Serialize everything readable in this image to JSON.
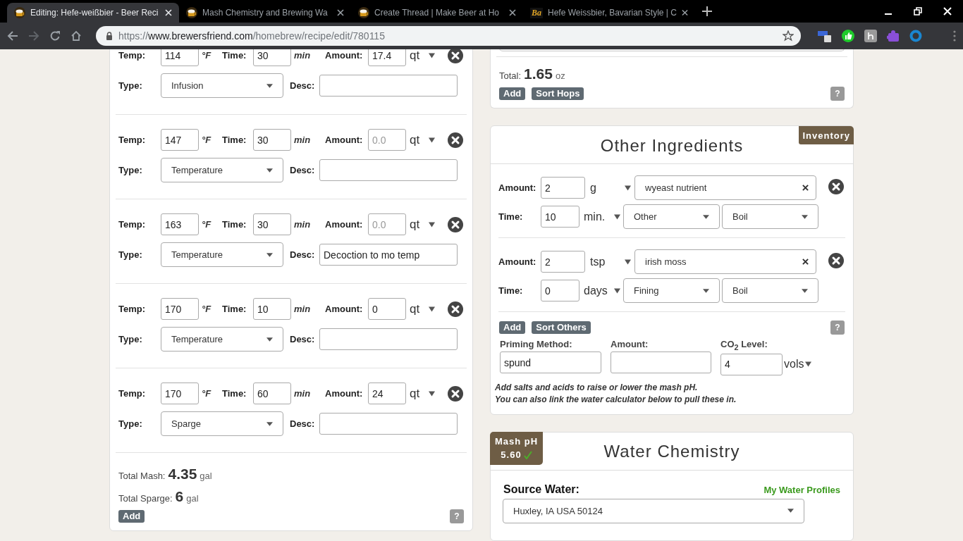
{
  "browser": {
    "tabs": [
      {
        "title": "Editing: Hefe-weißbier - Beer Reci",
        "kind": "mug",
        "selected": true
      },
      {
        "title": "Mash Chemistry and Brewing Wa",
        "kind": "mug",
        "selected": false
      },
      {
        "title": "Create Thread | Make Beer at Ho",
        "kind": "mug",
        "selected": false
      },
      {
        "title": "Hefe Weissbier, Bavarian Style | C",
        "kind": "letters",
        "icon_text": "Ba",
        "selected": false
      }
    ],
    "url": {
      "scheme": "https://",
      "host": "www.brewersfriend.com",
      "path": "/homebrew/recipe/edit/780115"
    }
  },
  "mash": {
    "steps": [
      {
        "temp": {
          "label": "Temp:",
          "value": "114",
          "unit": "°F"
        },
        "time": {
          "label": "Time:",
          "value": "30",
          "unit": "min"
        },
        "amount": {
          "label": "Amount:",
          "value": "17.4",
          "unit": "qt"
        },
        "type": {
          "label": "Type:",
          "value": "Infusion"
        },
        "desc": {
          "label": "Desc:"
        }
      },
      {
        "temp": {
          "label": "Temp:",
          "value": "147",
          "unit": "°F"
        },
        "time": {
          "label": "Time:",
          "value": "30",
          "unit": "min"
        },
        "amount": {
          "label": "Amount:",
          "placeholder": "0.0",
          "unit": "qt"
        },
        "type": {
          "label": "Type:",
          "value": "Temperature"
        },
        "desc": {
          "label": "Desc:"
        }
      },
      {
        "temp": {
          "label": "Temp:",
          "value": "163",
          "unit": "°F"
        },
        "time": {
          "label": "Time:",
          "value": "30",
          "unit": "min"
        },
        "amount": {
          "label": "Amount:",
          "placeholder": "0.0",
          "unit": "qt"
        },
        "type": {
          "label": "Type:",
          "value": "Temperature"
        },
        "desc": {
          "label": "Desc:",
          "value": "Decoction to mo temp"
        }
      },
      {
        "temp": {
          "label": "Temp:",
          "value": "170",
          "unit": "°F"
        },
        "time": {
          "label": "Time:",
          "value": "10",
          "unit": "min"
        },
        "amount": {
          "label": "Amount:",
          "value": "0",
          "unit": "qt"
        },
        "type": {
          "label": "Type:",
          "value": "Temperature"
        },
        "desc": {
          "label": "Desc:"
        }
      },
      {
        "temp": {
          "label": "Temp:",
          "value": "170",
          "unit": "°F"
        },
        "time": {
          "label": "Time:",
          "value": "60",
          "unit": "min"
        },
        "amount": {
          "label": "Amount:",
          "value": "24",
          "unit": "qt"
        },
        "type": {
          "label": "Type:",
          "value": "Sparge"
        },
        "desc": {
          "label": "Desc:"
        }
      }
    ],
    "total_mash": {
      "label": "Total Mash:",
      "value": "4.35",
      "unit": "gal"
    },
    "total_sparge": {
      "label": "Total Sparge:",
      "value": "6",
      "unit": "gal"
    },
    "buttons": [
      "Add"
    ],
    "help": "?"
  },
  "hops": {
    "total": {
      "label": "Total:",
      "value": "1.65",
      "unit": "oz"
    },
    "buttons": [
      "Add",
      "Sort Hops"
    ],
    "help": "?"
  },
  "other_ingredients": {
    "title": "Other Ingredients",
    "inventory_tab": "Inventory",
    "items": [
      {
        "amount_label": "Amount:",
        "amount": "2",
        "unit": "g",
        "name": "wyeast nutrient",
        "time_label": "Time:",
        "time": "10",
        "time_unit": "min.",
        "use": "Other",
        "stage": "Boil"
      },
      {
        "amount_label": "Amount:",
        "amount": "2",
        "unit": "tsp",
        "name": "irish moss",
        "time_label": "Time:",
        "time": "0",
        "time_unit": "days",
        "use": "Fining",
        "stage": "Boil"
      }
    ],
    "buttons": [
      "Add",
      "Sort Others"
    ],
    "help": "?",
    "priming": {
      "method_label": "Priming Method:",
      "method": "spund",
      "amount_label": "Amount:",
      "co2_label": "CO$_{2}$ Level:",
      "co2": "4",
      "co2_unit": "vols"
    },
    "notes": [
      "Add salts and acids to raise or lower the mash pH.",
      "You can also link the water calculator below to pull these in."
    ]
  },
  "water_chemistry": {
    "badge": {
      "label": "Mash pH",
      "value": "5.60",
      "ok": true
    },
    "title": "Water Chemistry",
    "source_label": "Source Water:",
    "profiles_link": "My Water Profiles",
    "source": "Huxley, IA USA 50124"
  }
}
